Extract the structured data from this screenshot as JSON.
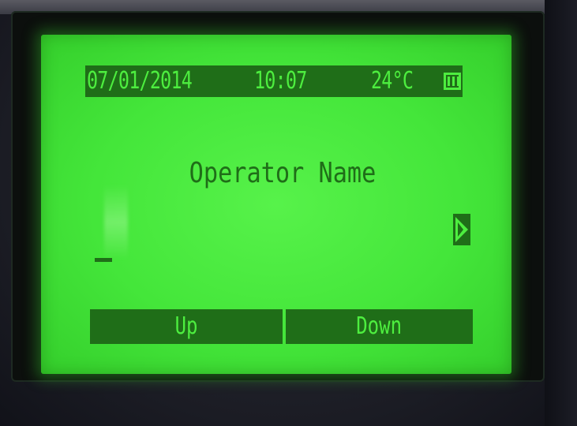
{
  "status_bar": {
    "date": "07/01/2014",
    "time": "10:07",
    "temperature": "24°C",
    "battery_icon": "battery-icon"
  },
  "screen": {
    "title": "Operator Name",
    "next_icon": "chevron-right-icon",
    "input_value": ""
  },
  "softkeys": {
    "left": "Up",
    "right": "Down"
  },
  "colors": {
    "lcd_background": "#44e63a",
    "lcd_foreground": "#1f6e18"
  }
}
